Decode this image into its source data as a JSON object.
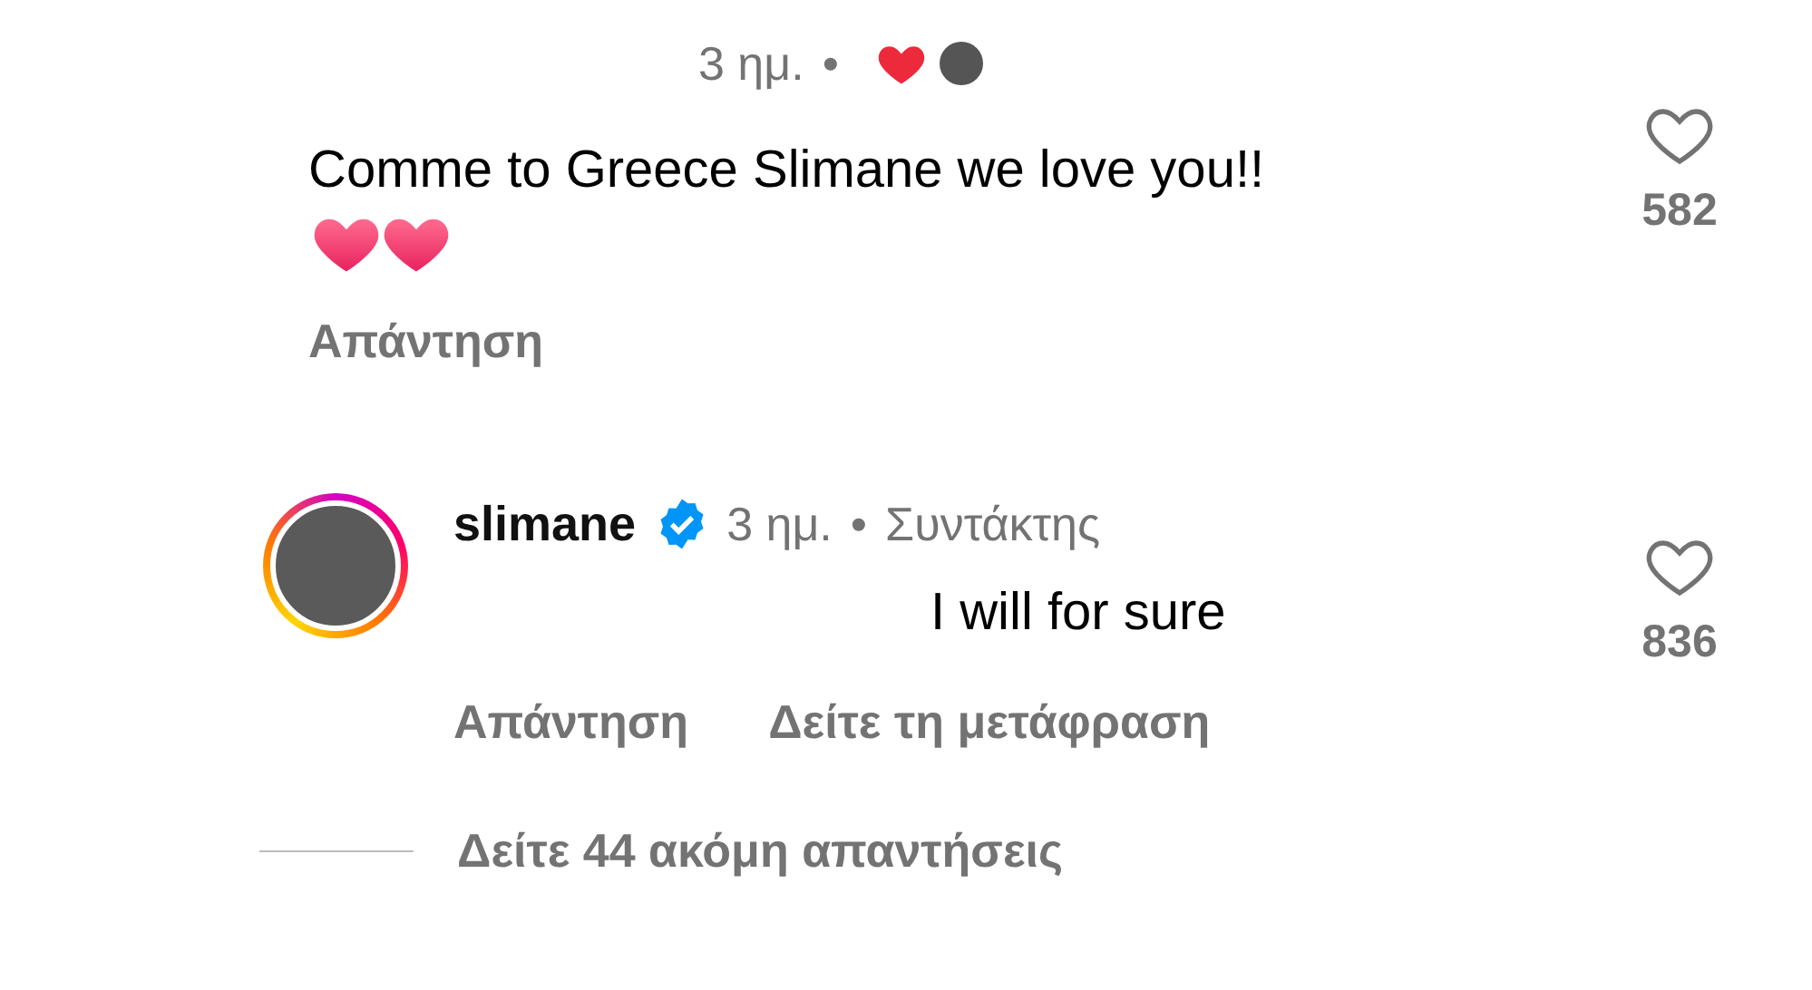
{
  "comments": [
    {
      "time": "3 ημ.",
      "separator": "•",
      "liked_by_author": true,
      "text": "Comme to Greece Slimane we love you!!",
      "hearts_emoji": true,
      "actions": [
        "Απάντηση"
      ],
      "liked": false,
      "likes": "582"
    },
    {
      "username": "slimane",
      "verified": true,
      "time": "3 ημ.",
      "separator": "•",
      "role": "Συντάκτης",
      "liked_by_author": false,
      "text": "I will for sure",
      "hearts_emoji": false,
      "actions": [
        "Απάντηση",
        "Δείτε τη μετάφραση"
      ],
      "liked": false,
      "likes": "836"
    }
  ],
  "view_more_replies": "Δείτε 44 ακόμη απαντήσεις"
}
